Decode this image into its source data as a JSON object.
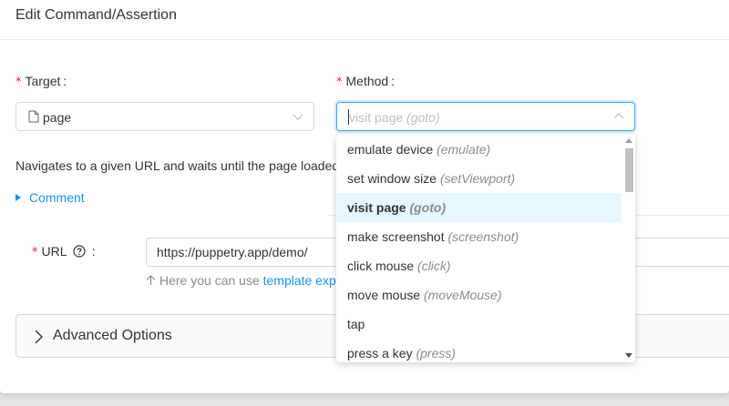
{
  "modal": {
    "title": "Edit Command/Assertion"
  },
  "target": {
    "label": "Target",
    "required_mark": "*",
    "colon": ":",
    "value": "page"
  },
  "method": {
    "label": "Method",
    "required_mark": "*",
    "colon": ":",
    "placeholder_main": "visit page",
    "placeholder_sub": "(goto)"
  },
  "description": "Navigates to a given URL and waits until the page loaded",
  "comment": {
    "label": "Comment"
  },
  "url": {
    "label": "URL",
    "required_mark": "*",
    "colon": ":",
    "value": "https://puppetry.app/demo/",
    "hint_prefix": "Here you can use",
    "hint_link": "template exp"
  },
  "advanced": {
    "label": "Advanced Options"
  },
  "dropdown": {
    "selected_index": 2,
    "options": [
      {
        "label": "emulate device",
        "sub": "(emulate)"
      },
      {
        "label": "set window size",
        "sub": "(setViewport)"
      },
      {
        "label": "visit page",
        "sub": "(goto)"
      },
      {
        "label": "make screenshot",
        "sub": "(screenshot)"
      },
      {
        "label": "click mouse",
        "sub": "(click)"
      },
      {
        "label": "move mouse",
        "sub": "(moveMouse)"
      },
      {
        "label": "tap",
        "sub": ""
      },
      {
        "label": "press a key",
        "sub": "(press)"
      }
    ]
  },
  "colors": {
    "accent": "#1890ff",
    "required": "#f5222d",
    "selected_bg": "#e6f7ff"
  }
}
